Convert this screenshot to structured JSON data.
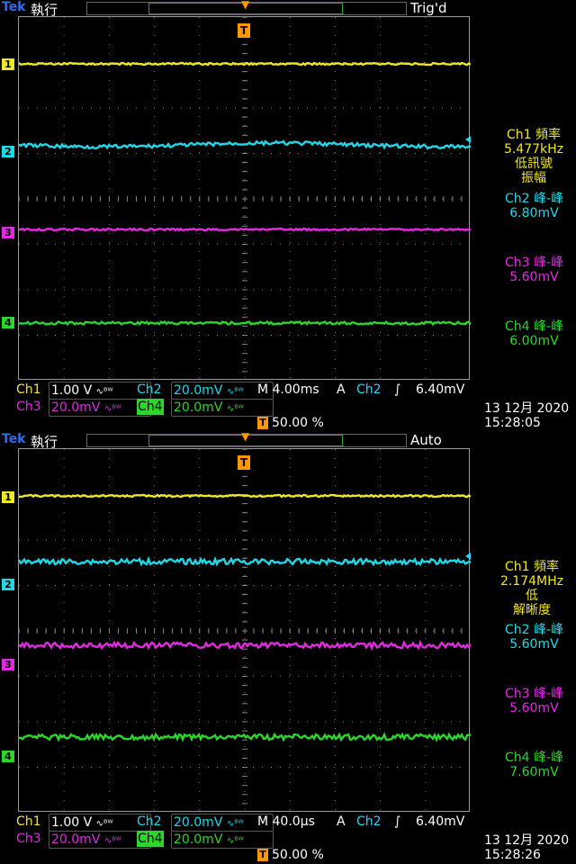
{
  "colors": {
    "ch1": "#f0e629",
    "ch2": "#22d8e8",
    "ch3": "#e22be0",
    "ch4": "#2ed52e",
    "trigger": "#ff9800",
    "brand": "#2f6fe8"
  },
  "screens": [
    {
      "brand": "Tek",
      "mode": "執行",
      "trig_status": "Trig'd",
      "trigger_marker": "T",
      "channel_markers": [
        "1",
        "2",
        "3",
        "4"
      ],
      "measurements": {
        "ch1": {
          "title": "Ch1 頻率",
          "value": "5.477kHz",
          "note1": "低訊號",
          "note2": "振幅"
        },
        "ch2": {
          "title": "Ch2 峰-峰",
          "value": "6.80mV"
        },
        "ch3": {
          "title": "Ch3 峰-峰",
          "value": "5.60mV"
        },
        "ch4": {
          "title": "Ch4 峰-峰",
          "value": "6.00mV"
        }
      },
      "status": {
        "ch1_label": "Ch1",
        "ch1_scale": "1.00 V",
        "ch2_label": "Ch2",
        "ch2_scale": "20.0mV",
        "ch3_label": "Ch3",
        "ch3_scale": "20.0mV",
        "ch4_label": "Ch4",
        "ch4_scale": "20.0mV",
        "timebase": "M 4.00ms",
        "trig_label": "A",
        "trig_source": "Ch2",
        "trig_slope": "∫",
        "trig_level": "6.40mV",
        "trig_position": "50.00 %",
        "bw_symbol": "∿ᴮᵂ"
      },
      "date": "13 12月 2020",
      "time": "15:28:05"
    },
    {
      "brand": "Tek",
      "mode": "執行",
      "trig_status": "Auto",
      "trigger_marker": "T",
      "channel_markers": [
        "1",
        "2",
        "3",
        "4"
      ],
      "measurements": {
        "ch1": {
          "title": "Ch1 頻率",
          "value": "2.174MHz",
          "note1": "低",
          "note2": "解晰度"
        },
        "ch2": {
          "title": "Ch2 峰-峰",
          "value": "5.60mV"
        },
        "ch3": {
          "title": "Ch3 峰-峰",
          "value": "5.60mV"
        },
        "ch4": {
          "title": "Ch4 峰-峰",
          "value": "7.60mV"
        }
      },
      "status": {
        "ch1_label": "Ch1",
        "ch1_scale": "1.00 V",
        "ch2_label": "Ch2",
        "ch2_scale": "20.0mV",
        "ch3_label": "Ch3",
        "ch3_scale": "20.0mV",
        "ch4_label": "Ch4",
        "ch4_scale": "20.0mV",
        "timebase": "M 40.0µs",
        "trig_label": "A",
        "trig_source": "Ch2",
        "trig_slope": "∫",
        "trig_level": "6.40mV",
        "trig_position": "50.00 %",
        "bw_symbol": "∿ᴮᵂ"
      },
      "date": "13 12月 2020",
      "time": "15:28:26"
    }
  ]
}
